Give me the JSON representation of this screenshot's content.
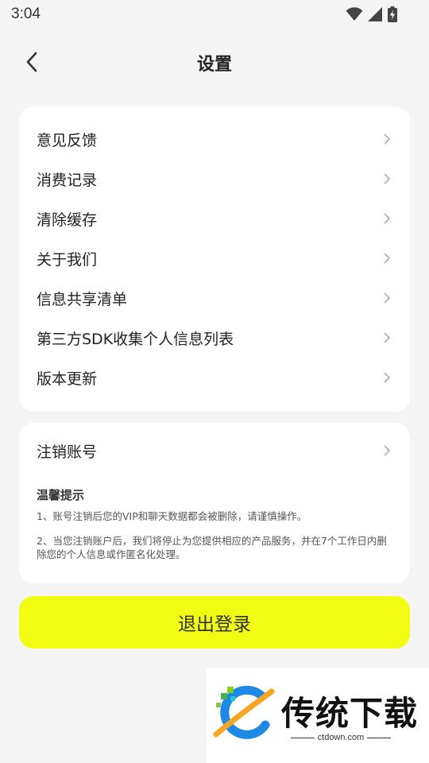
{
  "status_bar": {
    "time": "3:04",
    "icons": [
      "wifi-icon",
      "cellular-signal-icon",
      "battery-charging-icon"
    ]
  },
  "header": {
    "title": "设置",
    "back_icon": "chevron-left-icon"
  },
  "settings_menu": {
    "items": [
      {
        "label": "意见反馈"
      },
      {
        "label": "消费记录"
      },
      {
        "label": "清除缓存"
      },
      {
        "label": "关于我们"
      },
      {
        "label": "信息共享清单"
      },
      {
        "label": "第三方SDK收集个人信息列表"
      },
      {
        "label": "版本更新"
      }
    ]
  },
  "account": {
    "cancel_label": "注销账号",
    "tip_title": "温馨提示",
    "tips": [
      "1、账号注销后您的VIP和聊天数据都会被删除，请谨慎操作。",
      "2、当您注销账户后，我们将停止为您提供相应的产品服务，并在7个工作日内删除您的个人信息或作匿名化处理。"
    ]
  },
  "logout_label": "退出登录",
  "watermark": {
    "name": "传统下载",
    "url": "ctdown.com"
  },
  "colors": {
    "background": "#f4f4f4",
    "card": "#ffffff",
    "accent_yellow": "#f2fb12",
    "chevron": "#b0b0b0"
  }
}
